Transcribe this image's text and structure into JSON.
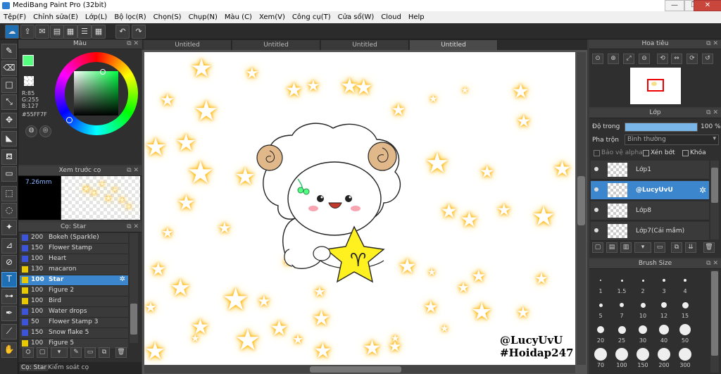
{
  "window": {
    "title": "MediBang Paint Pro (32bit)",
    "minimize": "—",
    "maximize": "❐",
    "close": "✕"
  },
  "menu": [
    "Tệp(F)",
    "Chỉnh sửa(E)",
    "Lớp(L)",
    "Bộ lọc(R)",
    "Chọn(S)",
    "Chụp(N)",
    "Màu (C)",
    "Xem(V)",
    "Công cụ(T)",
    "Cửa sổ(W)",
    "Cloud",
    "Help"
  ],
  "color_panel": {
    "title": "Màu",
    "r": "R:85",
    "g": "G:255",
    "b": "B:127",
    "hex": "#55FF7F",
    "current_color": "#55FF7F"
  },
  "preview_panel": {
    "title": "Xem trước cọ",
    "size": "7.26mm"
  },
  "brush_panel": {
    "title": "Cọ: Star",
    "items": [
      {
        "size": "200",
        "name": "Bokeh (Sparkle)",
        "color": "#3b54d9"
      },
      {
        "size": "150",
        "name": "Flower Stamp",
        "color": "#3b54d9"
      },
      {
        "size": "100",
        "name": "Heart",
        "color": "#3b54d9"
      },
      {
        "size": "130",
        "name": "macaron",
        "color": "#e8c800"
      },
      {
        "size": "100",
        "name": "Star",
        "color": "#e8c800",
        "selected": true
      },
      {
        "size": "100",
        "name": "Figure 2",
        "color": "#e8c800"
      },
      {
        "size": "100",
        "name": "Bird",
        "color": "#e8c800"
      },
      {
        "size": "100",
        "name": "Water drops",
        "color": "#3b54d9"
      },
      {
        "size": "50",
        "name": "Flower Stamp 3",
        "color": "#3b54d9"
      },
      {
        "size": "150",
        "name": "Snow flake 5",
        "color": "#3b54d9"
      },
      {
        "size": "100",
        "name": "Figure 5",
        "color": "#e8c800"
      }
    ]
  },
  "bottom_tabs": [
    "Cọ: Star",
    "Kiểm soát cọ"
  ],
  "tabs": [
    "Untitled",
    "Untitled",
    "Untitled",
    "Untitled"
  ],
  "nav_panel": {
    "title": "Hoa tiêu"
  },
  "layer_panel": {
    "title": "Lớp",
    "opacity_label": "Độ trong",
    "opacity_value": "100 %",
    "opacity": 1.0,
    "blend_label": "Pha trộn",
    "blend_value": "Bình thường",
    "protect_alpha": "Bảo vệ alpha",
    "clipping": "Xén bớt",
    "lock": "Khóa",
    "layers": [
      {
        "name": "Lớp1",
        "selected": false
      },
      {
        "name": "@LucyUvU",
        "selected": true
      },
      {
        "name": "Lớp8",
        "selected": false
      },
      {
        "name": "Lớp7(Cái mầm)",
        "selected": false
      }
    ]
  },
  "brush_size_panel": {
    "title": "Brush Size",
    "sizes": [
      "1",
      "1.5",
      "2",
      "3",
      "4",
      "5",
      "7",
      "10",
      "12",
      "15",
      "20",
      "25",
      "30",
      "40",
      "50",
      "70",
      "100",
      "150",
      "200",
      "300"
    ]
  },
  "canvas": {
    "signature_line1": "@LucyUvU",
    "signature_line2": "#Hoidap247",
    "star_mark": "♈"
  },
  "icons": {
    "undo": "↶",
    "redo": "↷",
    "settings": "✲"
  }
}
